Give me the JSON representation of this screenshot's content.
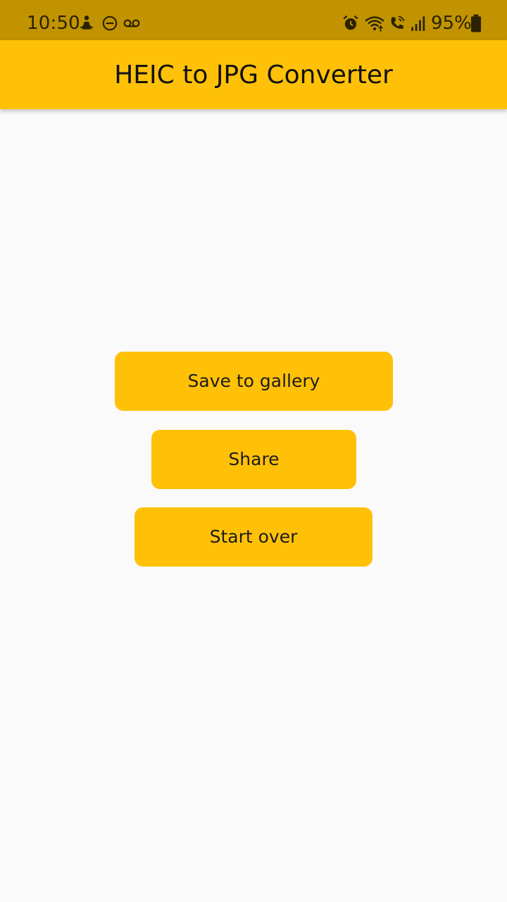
{
  "status_bar": {
    "time": "10:50",
    "left_icons": [
      "person-notification-icon",
      "do-not-disturb-icon",
      "voicemail-icon"
    ],
    "right_icons": [
      "alarm-icon",
      "wifi-icon",
      "wifi-calling-icon",
      "signal-icon",
      "battery-icon"
    ],
    "battery": "95%"
  },
  "app_bar": {
    "title": "HEIC to JPG Converter"
  },
  "actions": {
    "save_label": "Save to gallery",
    "share_label": "Share",
    "start_over_label": "Start over"
  },
  "colors": {
    "accent": "#FFC107",
    "status_bar": "#C19300",
    "background": "#FAFAFA"
  }
}
